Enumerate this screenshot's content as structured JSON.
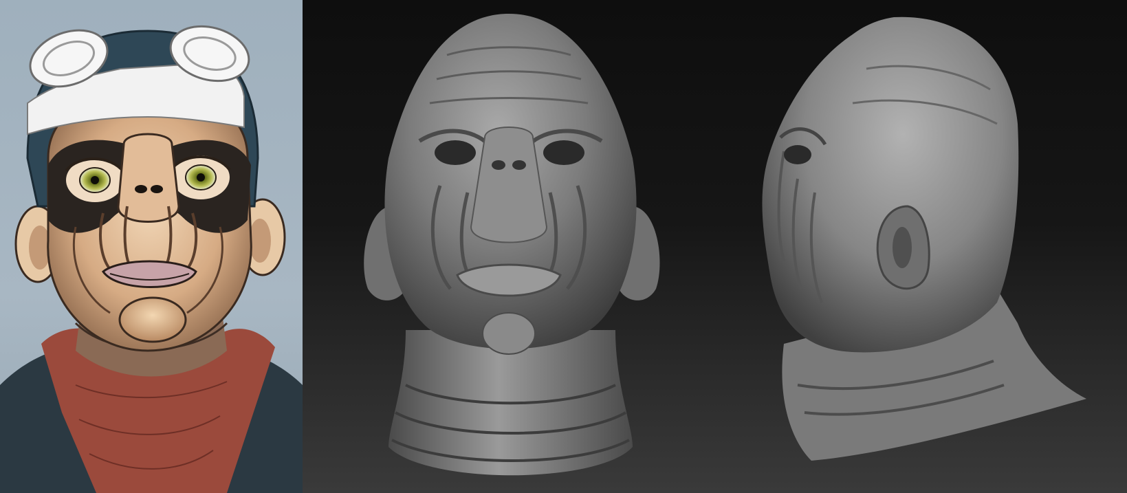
{
  "scene": {
    "panels": [
      {
        "id": "concept-illustration",
        "subject": "color-sketch-of-alien-pilot-portrait"
      },
      {
        "id": "sculpt-front-view",
        "subject": "grey-3d-sculpt-head-front"
      },
      {
        "id": "sculpt-side-view",
        "subject": "grey-3d-sculpt-head-three-quarter-profile"
      }
    ],
    "colors": {
      "concept_background": "#a3b3bf",
      "cap": "#2e4756",
      "goggles": "#f2f2f2",
      "skin": "#d9b48f",
      "scarf": "#9b4a3c",
      "jacket": "#2b3942",
      "render_background_top": "#0e0e0e",
      "render_background_bottom": "#3a3a3a",
      "sculpt_grey": "#8a8a8a"
    }
  }
}
